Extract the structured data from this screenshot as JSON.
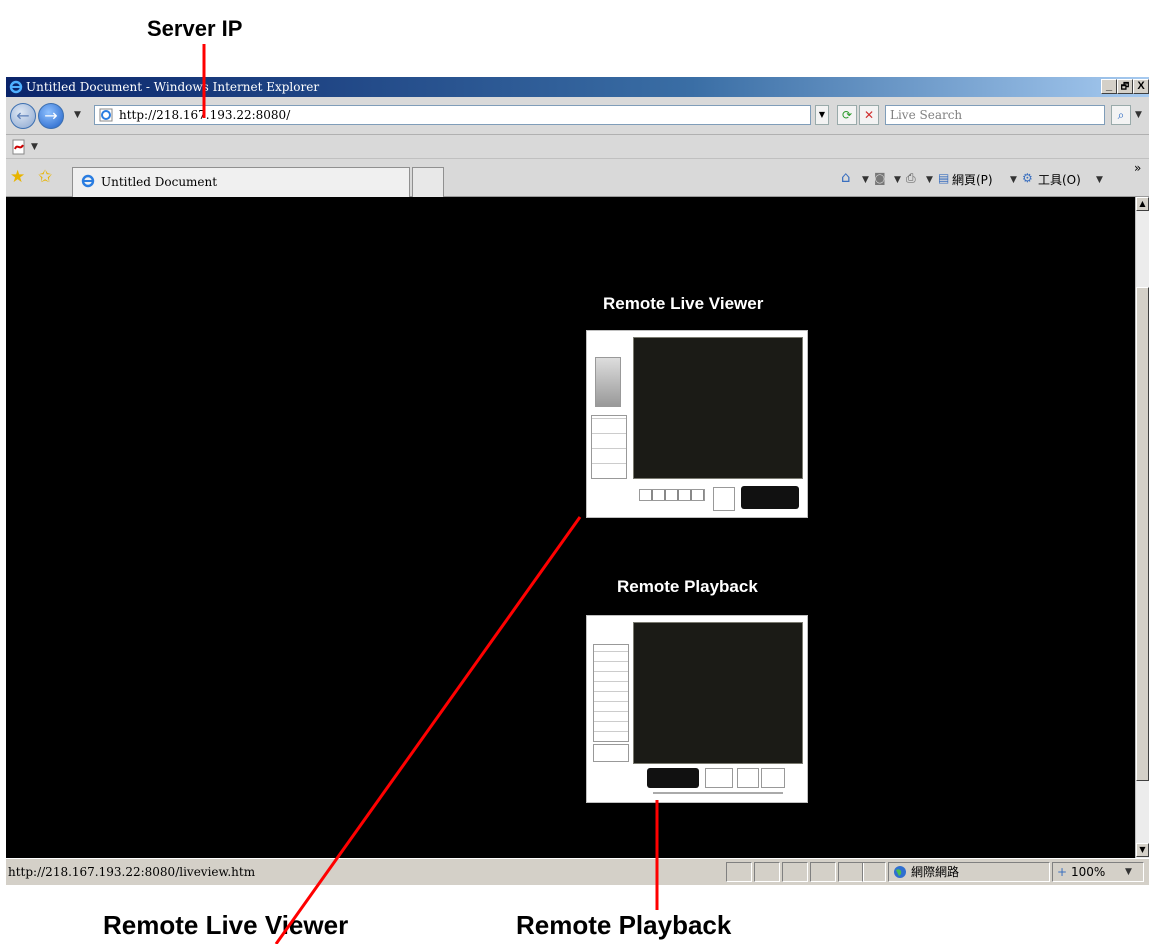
{
  "annotations": {
    "server_ip": "Server IP",
    "remote_live_viewer": "Remote Live Viewer",
    "remote_playback": "Remote Playback"
  },
  "window": {
    "title": "Untitled Document - Windows Internet Explorer",
    "buttons": {
      "minimize": "_",
      "maximize": "🗗",
      "close": "X"
    }
  },
  "address_bar": {
    "url": "http://218.167.193.22:8080/",
    "search_placeholder": "Live Search"
  },
  "tabs": {
    "active_label": "Untitled Document"
  },
  "command_bar": {
    "page_label": "網頁(P)",
    "tools_label": "工具(O)"
  },
  "content": {
    "live_viewer_title": "Remote Live Viewer",
    "playback_title": "Remote Playback"
  },
  "status_bar": {
    "url": "http://218.167.193.22:8080/liveview.htm",
    "zone": "網際網路",
    "zoom": "100%"
  },
  "colors": {
    "annotation_line": "#ff0000",
    "content_bg": "#000000",
    "titlebar_start": "#0a246a"
  },
  "icons": [
    "ie-logo-icon",
    "back-icon",
    "forward-icon",
    "refresh-icon",
    "stop-icon",
    "search-icon",
    "favorites-star-icon",
    "add-favorites-icon",
    "home-icon",
    "feeds-icon",
    "print-icon",
    "page-icon",
    "tools-gear-icon",
    "internet-globe-icon",
    "zoom-icon"
  ]
}
